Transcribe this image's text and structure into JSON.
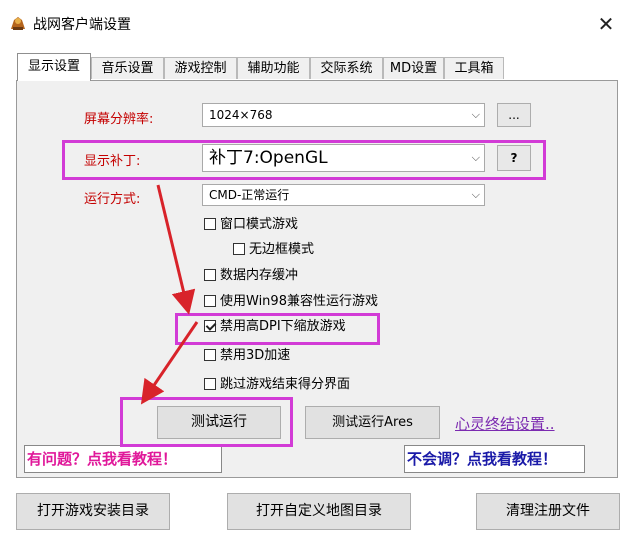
{
  "window": {
    "title": "战网客户端设置",
    "close_glyph": "✕"
  },
  "tabs": [
    {
      "label": "显示设置",
      "active": true
    },
    {
      "label": "音乐设置",
      "active": false
    },
    {
      "label": "游戏控制",
      "active": false
    },
    {
      "label": "辅助功能",
      "active": false
    },
    {
      "label": "交际系统",
      "active": false
    },
    {
      "label": "MD设置",
      "active": false
    },
    {
      "label": "工具箱",
      "active": false
    }
  ],
  "display": {
    "resolution_label": "屏幕分辨率:",
    "resolution_value": "1024×768",
    "resolution_more": "...",
    "patch_label": "显示补丁:",
    "patch_value": "补丁7:OpenGL",
    "patch_help": "?",
    "run_mode_label": "运行方式:",
    "run_mode_value": "CMD-正常运行"
  },
  "options": [
    {
      "label": "窗口模式游戏",
      "checked": false
    },
    {
      "label": "无边框模式",
      "checked": false
    },
    {
      "label": "数据内存缓冲",
      "checked": false
    },
    {
      "label": "使用Win98兼容性运行游戏",
      "checked": false
    },
    {
      "label": "禁用高DPI下缩放游戏",
      "checked": true
    },
    {
      "label": "禁用3D加速",
      "checked": false
    },
    {
      "label": "跳过游戏结束得分界面",
      "checked": false
    }
  ],
  "actions": {
    "test_run": "测试运行",
    "test_run_ares": "测试运行Ares",
    "link": "心灵终结设置.."
  },
  "help_banners": {
    "left": "有问题？点我看教程！",
    "right": "不会调？点我看教程！"
  },
  "bottom_buttons": {
    "open_install_dir": "打开游戏安装目录",
    "open_map_dir": "打开自定义地图目录",
    "clean_registry": "清理注册文件"
  },
  "colors": {
    "label_red": "#c40000",
    "highlight_magenta": "#d23bd6",
    "arrow_red": "#d8232a",
    "help_left": "#e0189a",
    "help_right": "#1a1aa8",
    "link_purple": "#7b2ab0"
  },
  "icons": {
    "app": "game-unit-icon",
    "dropdown": "chevron-down-icon"
  }
}
